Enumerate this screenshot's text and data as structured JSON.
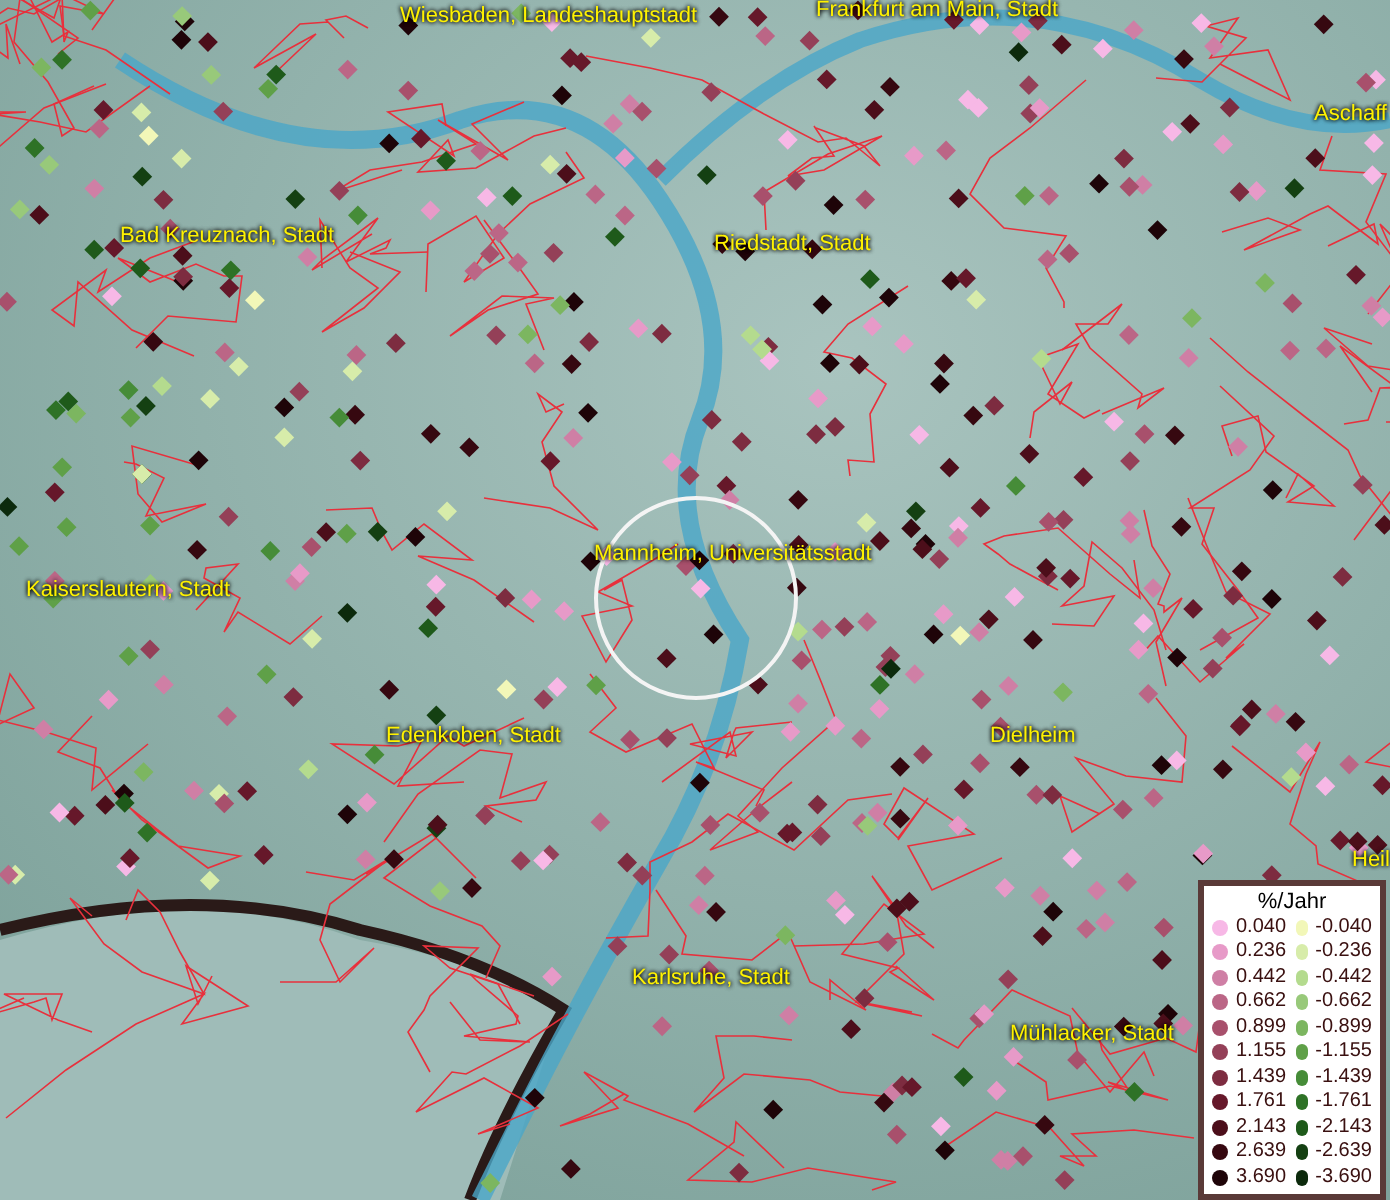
{
  "map_labels": [
    {
      "text": "Wiesbaden, Landeshauptstadt"
    },
    {
      "text": "Frankfurt am Main, Stadt"
    },
    {
      "text": "Aschaff"
    },
    {
      "text": "Bad Kreuznach, Stadt"
    },
    {
      "text": "Riedstadt, Stadt"
    },
    {
      "text": "Mannheim, Universitätsstadt"
    },
    {
      "text": "Kaiserslautern, Stadt"
    },
    {
      "text": "Edenkoben, Stadt"
    },
    {
      "text": "Dielheim"
    },
    {
      "text": "Heil"
    },
    {
      "text": "Karlsruhe, Stadt"
    },
    {
      "text": "Mühlacker, Stadt"
    }
  ],
  "legend": {
    "title": "%/Jahr",
    "positive": [
      {
        "label": "0.040",
        "color": "#f7b8e6"
      },
      {
        "label": "0.236",
        "color": "#e79ac8"
      },
      {
        "label": "0.442",
        "color": "#cf7fa5"
      },
      {
        "label": "0.662",
        "color": "#bb6686"
      },
      {
        "label": "0.899",
        "color": "#a8506c"
      },
      {
        "label": "1.155",
        "color": "#944058"
      },
      {
        "label": "1.439",
        "color": "#7d2c40"
      },
      {
        "label": "1.761",
        "color": "#66182a"
      },
      {
        "label": "2.143",
        "color": "#4c0e1a"
      },
      {
        "label": "2.639",
        "color": "#360810"
      },
      {
        "label": "3.690",
        "color": "#1e0408"
      }
    ],
    "negative": [
      {
        "label": "-0.040",
        "color": "#f2f7b8"
      },
      {
        "label": "-0.236",
        "color": "#d7ecaa"
      },
      {
        "label": "-0.442",
        "color": "#b4db8e"
      },
      {
        "label": "-0.662",
        "color": "#98c97a"
      },
      {
        "label": "-0.899",
        "color": "#7cb660"
      },
      {
        "label": "-1.155",
        "color": "#5fa048"
      },
      {
        "label": "-1.439",
        "color": "#468c38"
      },
      {
        "label": "-1.761",
        "color": "#2e7226"
      },
      {
        "label": "-2.143",
        "color": "#1e5a1a"
      },
      {
        "label": "-2.639",
        "color": "#144012"
      },
      {
        "label": "-3.690",
        "color": "#0c2a0c"
      }
    ]
  }
}
